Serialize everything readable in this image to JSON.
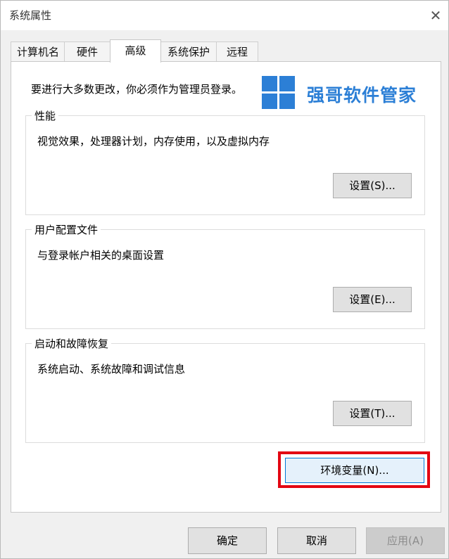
{
  "window": {
    "title": "系统属性",
    "close_glyph": "✕"
  },
  "tabs": [
    {
      "label": "计算机名"
    },
    {
      "label": "硬件"
    },
    {
      "label": "高级",
      "active": true
    },
    {
      "label": "系统保护"
    },
    {
      "label": "远程"
    }
  ],
  "notice": "要进行大多数更改，你必须作为管理员登录。",
  "watermark": {
    "text": "强哥软件管家",
    "icon": "windows-logo-icon",
    "color": "#2c7fd6"
  },
  "groups": {
    "performance": {
      "title": "性能",
      "description": "视觉效果，处理器计划，内存使用，以及虚拟内存",
      "button": "设置(S)..."
    },
    "user_profiles": {
      "title": "用户配置文件",
      "description": "与登录帐户相关的桌面设置",
      "button": "设置(E)..."
    },
    "startup_recovery": {
      "title": "启动和故障恢复",
      "description": "系统启动、系统故障和调试信息",
      "button": "设置(T)..."
    }
  },
  "env_button": {
    "label": "环境变量(N)...",
    "highlight_color": "#e30613"
  },
  "footer": {
    "ok": "确定",
    "cancel": "取消",
    "apply": "应用(A)"
  }
}
